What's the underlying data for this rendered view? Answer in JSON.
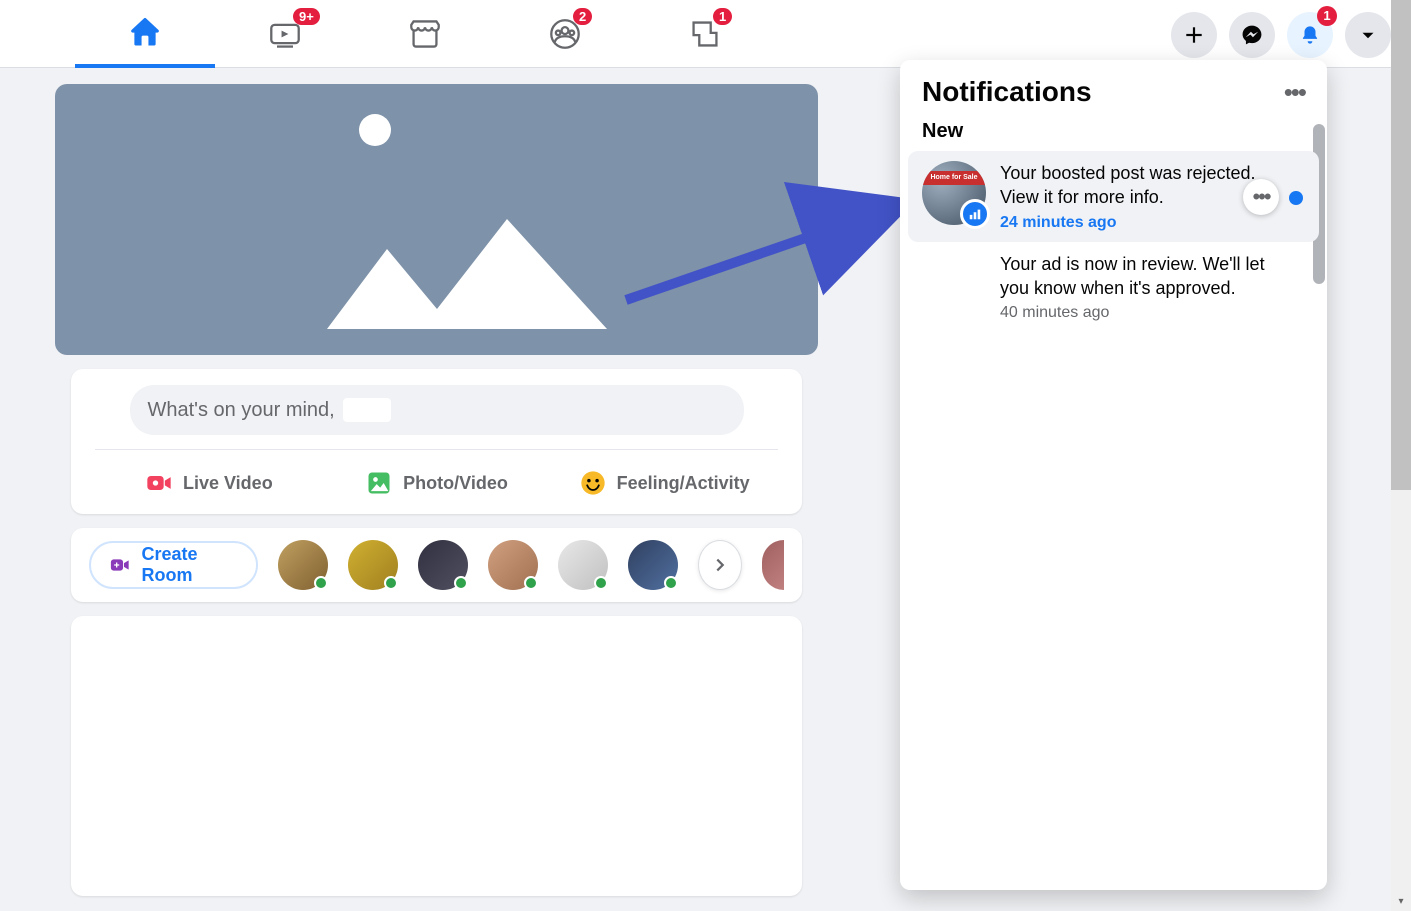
{
  "nav": {
    "tabs": [
      {
        "name": "home",
        "badge": null,
        "active": true
      },
      {
        "name": "watch",
        "badge": "9+",
        "active": false
      },
      {
        "name": "marketplace",
        "badge": null,
        "active": false
      },
      {
        "name": "groups",
        "badge": "2",
        "active": false
      },
      {
        "name": "gaming",
        "badge": "1",
        "active": false
      }
    ],
    "right": {
      "create_badge": null,
      "messenger_badge": null,
      "notifications_badge": "1",
      "account_badge": null
    }
  },
  "composer": {
    "placeholder": "What's on your mind,",
    "actions": {
      "live": "Live Video",
      "photo": "Photo/Video",
      "feeling": "Feeling/Activity"
    }
  },
  "rooms": {
    "create_label": "Create Room",
    "friend_count": 6
  },
  "notifications": {
    "title": "Notifications",
    "section_new": "New",
    "items": [
      {
        "text": "Your boosted post was rejected. View it for more info.",
        "time": "24 minutes ago",
        "unread": true,
        "highlight": true,
        "has_thumb": true,
        "show_more_btn": true
      },
      {
        "text": "Your ad is now in review. We'll let you know when it's approved.",
        "time": "40 minutes ago",
        "unread": false,
        "highlight": false,
        "has_thumb": false,
        "show_more_btn": false
      }
    ]
  },
  "colors": {
    "brand": "#1877f2",
    "badge_red": "#e41e3f",
    "online_green": "#31a24c"
  }
}
